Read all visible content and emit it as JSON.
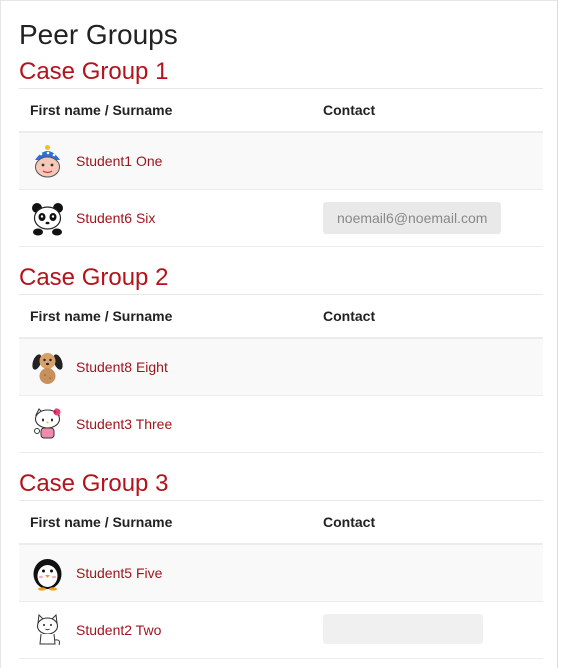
{
  "page_title": "Peer Groups",
  "columns": {
    "name": "First name / Surname",
    "contact": "Contact"
  },
  "colors": {
    "group_heading": "#b5121b",
    "link": "#a0151c"
  },
  "groups": [
    {
      "title": "Case Group 1",
      "students": [
        {
          "name": "Student1 One",
          "avatar": "clown-hat-avatar-icon",
          "email": ""
        },
        {
          "name": "Student6 Six",
          "avatar": "panda-avatar-icon",
          "email": "noemail6@noemail.com"
        }
      ]
    },
    {
      "title": "Case Group 2",
      "students": [
        {
          "name": "Student8 Eight",
          "avatar": "puppy-avatar-icon",
          "email": ""
        },
        {
          "name": "Student3 Three",
          "avatar": "hello-kitty-avatar-icon",
          "email": ""
        }
      ]
    },
    {
      "title": "Case Group 3",
      "students": [
        {
          "name": "Student5 Five",
          "avatar": "penguin-avatar-icon",
          "email": ""
        },
        {
          "name": "Student2 Two",
          "avatar": "cat-avatar-icon",
          "email": ""
        }
      ]
    }
  ]
}
